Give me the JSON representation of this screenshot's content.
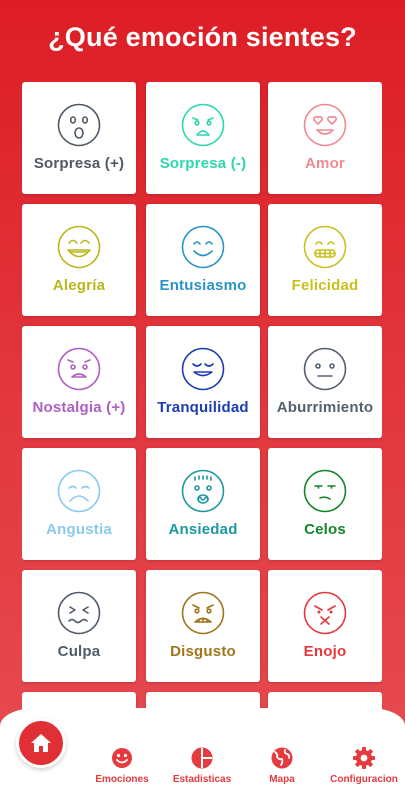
{
  "header": {
    "title": "¿Qué emoción sientes?"
  },
  "emotions": [
    {
      "label": "Sorpresa (+)",
      "color": "#4f5966",
      "icon": "surprised-face-icon"
    },
    {
      "label": "Sorpresa (-)",
      "color": "#2bd7ad",
      "icon": "shocked-face-icon"
    },
    {
      "label": "Amor",
      "color": "#ef8a91",
      "icon": "heart-eyes-face-icon"
    },
    {
      "label": "Alegría",
      "color": "#b9b71b",
      "icon": "laughing-face-icon"
    },
    {
      "label": "Entusiasmo",
      "color": "#2a94c6",
      "icon": "smiling-face-icon"
    },
    {
      "label": "Felicidad",
      "color": "#c9c01c",
      "icon": "grinning-face-icon"
    },
    {
      "label": "Nostalgia (+)",
      "color": "#b05ec5",
      "icon": "nostalgic-face-icon"
    },
    {
      "label": "Tranquilidad",
      "color": "#1d3db3",
      "icon": "calm-face-icon"
    },
    {
      "label": "Aburrimiento",
      "color": "#556070",
      "icon": "bored-face-icon"
    },
    {
      "label": "Angustia",
      "color": "#8cc9ee",
      "icon": "anguished-face-icon"
    },
    {
      "label": "Ansiedad",
      "color": "#1e98a0",
      "icon": "anxious-face-icon"
    },
    {
      "label": "Celos",
      "color": "#16852a",
      "icon": "jealous-face-icon"
    },
    {
      "label": "Culpa",
      "color": "#4f5c6b",
      "icon": "guilty-face-icon"
    },
    {
      "label": "Disgusto",
      "color": "#a0751c",
      "icon": "disgusted-face-icon"
    },
    {
      "label": "Enojo",
      "color": "#e5383c",
      "icon": "angry-face-icon"
    },
    {
      "label": "",
      "color": "#4f5966",
      "icon": ""
    },
    {
      "label": "",
      "color": "#4f5966",
      "icon": ""
    },
    {
      "label": "",
      "color": "#4f5966",
      "icon": ""
    }
  ],
  "nav": {
    "home_icon": "home-icon",
    "items": [
      {
        "label": "Emociones",
        "icon": "smiley-icon"
      },
      {
        "label": "Estadisticas",
        "icon": "pie-chart-icon"
      },
      {
        "label": "Mapa",
        "icon": "globe-icon"
      },
      {
        "label": "Configuracion",
        "icon": "gear-icon"
      }
    ],
    "color": "#e53a3e"
  }
}
